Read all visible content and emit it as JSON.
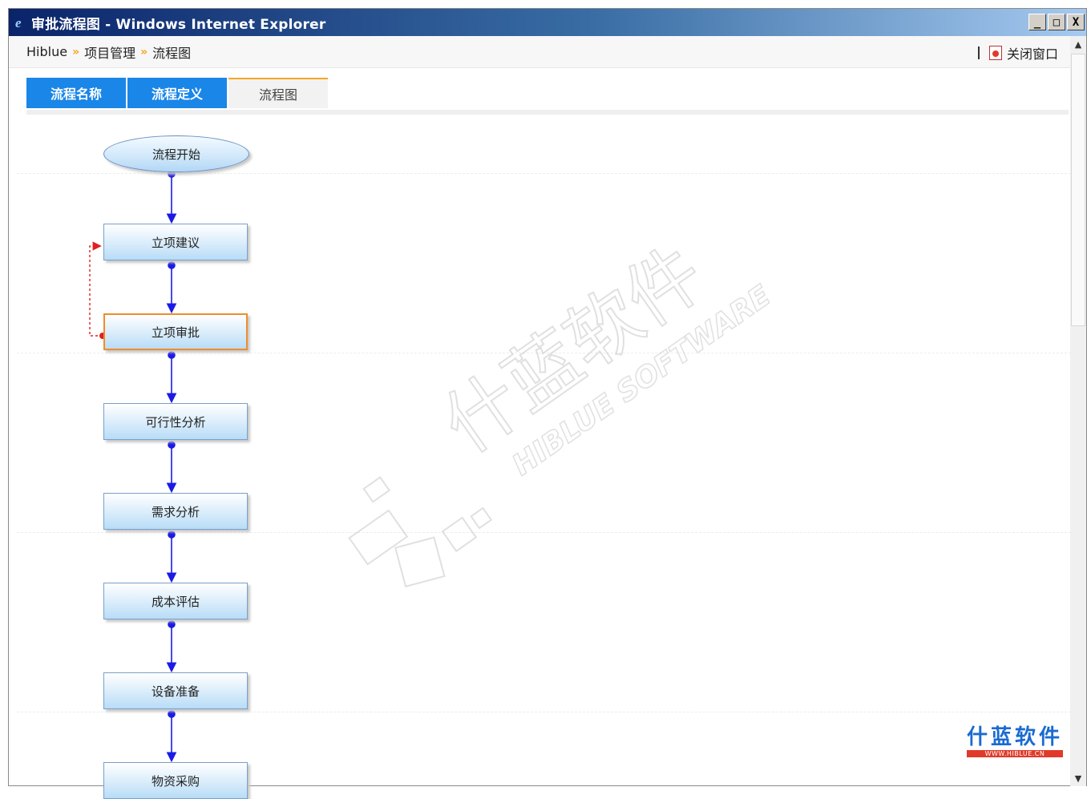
{
  "window": {
    "title": "审批流程图 - Windows Internet Explorer",
    "controls": {
      "minimize": "_",
      "maximize": "□",
      "close": "X"
    }
  },
  "breadcrumb": {
    "items": [
      "Hiblue",
      "项目管理",
      "流程图"
    ],
    "separator": "»",
    "close_window": "关闭窗口"
  },
  "tabs": [
    {
      "label": "流程名称",
      "active": false
    },
    {
      "label": "流程定义",
      "active": false
    },
    {
      "label": "流程图",
      "active": true
    }
  ],
  "flow": {
    "start": "流程开始",
    "nodes": [
      "立项建议",
      "立项审批",
      "可行性分析",
      "需求分析",
      "成本评估",
      "设备准备",
      "物资采购"
    ],
    "selected_node": "立项审批",
    "return_link": {
      "from": "立项审批",
      "to": "立项建议"
    }
  },
  "watermark": {
    "text": "HIBLUE SOFTWARE",
    "brand": "什蓝软件"
  },
  "logo": {
    "name": "什蓝软件",
    "url": "WWW.HIBLUE.CN"
  },
  "colors": {
    "tab_blue": "#1a86e8",
    "accent_orange": "#f5a623",
    "arrow_blue": "#1a1ae6",
    "return_red": "#e02020"
  }
}
